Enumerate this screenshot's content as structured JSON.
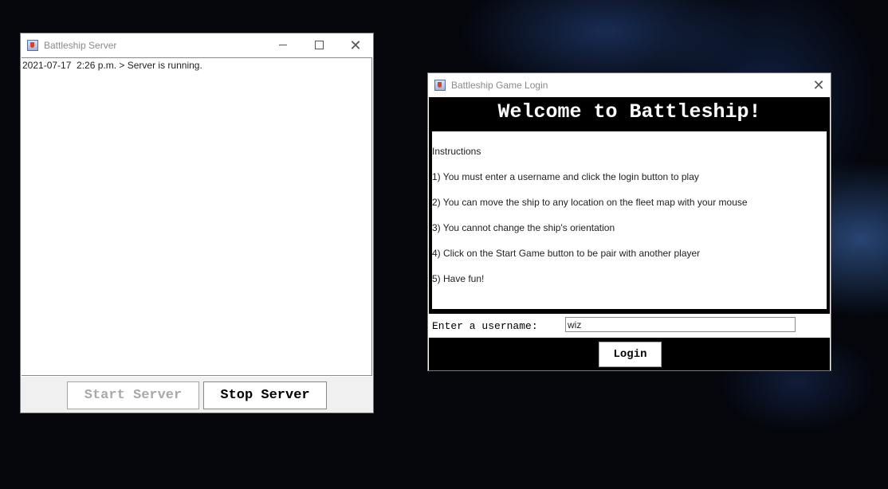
{
  "server_window": {
    "title": "Battleship Server",
    "log_lines": [
      "2021-07-17  2:26 p.m. > Server is running."
    ],
    "start_button": "Start Server",
    "stop_button": "Stop Server"
  },
  "login_window": {
    "title": "Battleship Game Login",
    "welcome": "Welcome to Battleship!",
    "instructions": [
      "Instructions",
      "1) You must enter a username and click the login button to play",
      "2) You can move the ship to any location on the fleet map with your mouse",
      "3) You cannot change the ship's orientation",
      "4) Click on the Start Game button to be pair with another player",
      "5) Have fun!"
    ],
    "username_label": "Enter a username:",
    "username_value": "wiz",
    "login_button": "Login"
  },
  "icons": {
    "app": "java-cup-icon",
    "minimize": "minimize-icon",
    "maximize": "maximize-icon",
    "close": "close-icon"
  }
}
